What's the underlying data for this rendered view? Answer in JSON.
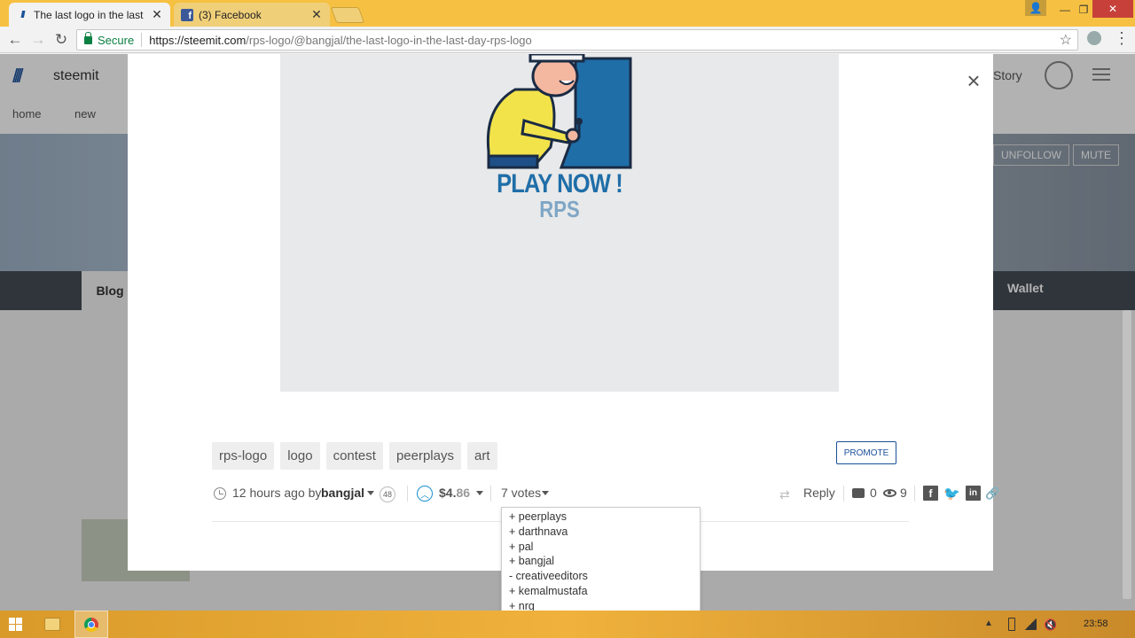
{
  "browser": {
    "tabs": [
      {
        "title": "The last logo in the last d",
        "favicon": "steemit-icon",
        "active": true
      },
      {
        "title": "(3) Facebook",
        "favicon": "facebook-icon",
        "active": false
      }
    ],
    "address": {
      "secure_label": "Secure",
      "url_host": "https://steemit.com",
      "url_path": "/rps-logo/@bangjal/the-last-logo-in-the-last-day-rps-logo"
    },
    "window_controls": {
      "minimize": "—",
      "maximize": "❐",
      "close": "✕"
    }
  },
  "background_page": {
    "brand": "steemit",
    "nav": [
      "home",
      "new"
    ],
    "header_right": "Story",
    "profile_buttons": [
      "UNFOLLOW",
      "MUTE"
    ],
    "tabs": {
      "blog": "Blog",
      "wallet": "Wallet"
    }
  },
  "post_image": {
    "headline": "PLAY NOW !",
    "subline": "RPS"
  },
  "post": {
    "tags": [
      "rps-logo",
      "logo",
      "contest",
      "peerplays",
      "art"
    ],
    "promote_label": "PROMOTE",
    "time_ago": "12 hours ago",
    "by_label": "by",
    "author": "bangjal",
    "reputation": "48",
    "payout_main": "$4.",
    "payout_cents": "86",
    "votes_label": "7 votes",
    "reply_label": "Reply",
    "comment_count": "0",
    "view_count": "9"
  },
  "voters": [
    "+ peerplays",
    "+ darthnava",
    "+ pal",
    "+ bangjal",
    "- creativeeditors",
    "+ kemalmustafa",
    "+ nrg"
  ],
  "taskbar": {
    "time": "23:58"
  },
  "colors": {
    "titlebar": "#f6c142",
    "steem_blue": "#1a5099",
    "secure_green": "#0b8043",
    "taskbar": "#f0b23c"
  }
}
